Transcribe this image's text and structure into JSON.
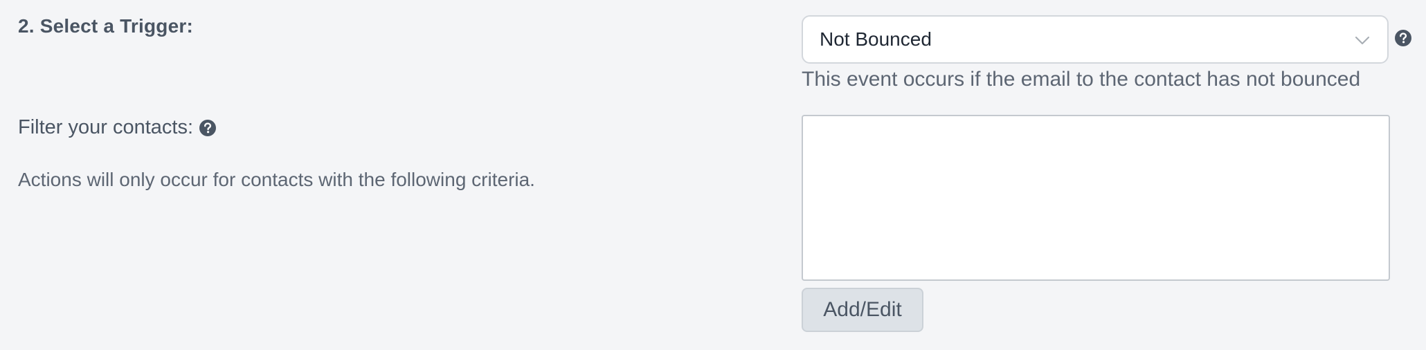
{
  "section": {
    "title": "2. Select a Trigger:"
  },
  "trigger": {
    "selected": "Not Bounced",
    "description": "This event occurs if the email to the contact has not bounced"
  },
  "filter": {
    "label": "Filter your contacts:",
    "info": "Actions will only occur for contacts with the following criteria.",
    "criteria_text": ""
  },
  "buttons": {
    "add_edit": "Add/Edit"
  },
  "icons": {
    "help": "question-circle-icon",
    "dropdown": "chevron-down-icon"
  },
  "colors": {
    "background": "#f4f5f7",
    "text": "#4a5563",
    "icon": "#4a5563"
  }
}
